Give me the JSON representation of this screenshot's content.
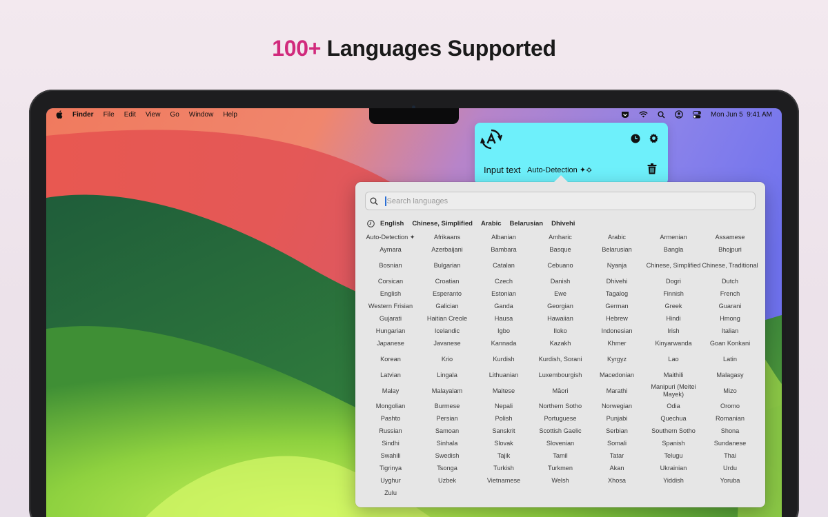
{
  "headline": {
    "accent": "100+",
    "rest": " Languages Supported"
  },
  "menubar": {
    "items": [
      "Finder",
      "File",
      "Edit",
      "View",
      "Go",
      "Window",
      "Help"
    ],
    "datetime": "Mon Jun 5  9:41 AM"
  },
  "popup": {
    "input_label": "Input text",
    "source_language": "Auto-Detection ✦≎"
  },
  "panel": {
    "search_placeholder": "Search languages",
    "recent": [
      "English",
      "Chinese, Simplified",
      "Arabic",
      "Belarusian",
      "Dhivehi"
    ],
    "languages": [
      [
        "Auto-Detection ✦",
        "Afrikaans",
        "Albanian",
        "Amharic",
        "Arabic",
        "Armenian",
        "Assamese"
      ],
      [
        "Aymara",
        "Azerbaijani",
        "Bambara",
        "Basque",
        "Belarusian",
        "Bangla",
        "Bhojpuri"
      ],
      [
        "Bosnian",
        "Bulgarian",
        "Catalan",
        "Cebuano",
        "Nyanja",
        "Chinese, Simplified",
        "Chinese, Traditional"
      ],
      [
        "Corsican",
        "Croatian",
        "Czech",
        "Danish",
        "Dhivehi",
        "Dogri",
        "Dutch"
      ],
      [
        "English",
        "Esperanto",
        "Estonian",
        "Ewe",
        "Tagalog",
        "Finnish",
        "French"
      ],
      [
        "Western Frisian",
        "Galician",
        "Ganda",
        "Georgian",
        "German",
        "Greek",
        "Guarani"
      ],
      [
        "Gujarati",
        "Haitian Creole",
        "Hausa",
        "Hawaiian",
        "Hebrew",
        "Hindi",
        "Hmong"
      ],
      [
        "Hungarian",
        "Icelandic",
        "Igbo",
        "Iloko",
        "Indonesian",
        "Irish",
        "Italian"
      ],
      [
        "Japanese",
        "Javanese",
        "Kannada",
        "Kazakh",
        "Khmer",
        "Kinyarwanda",
        "Goan Konkani"
      ],
      [
        "Korean",
        "Krio",
        "Kurdish",
        "Kurdish, Sorani",
        "Kyrgyz",
        "Lao",
        "Latin"
      ],
      [
        "Latvian",
        "Lingala",
        "Lithuanian",
        "Luxembourgish",
        "Macedonian",
        "Maithili",
        "Malagasy"
      ],
      [
        "Malay",
        "Malayalam",
        "Maltese",
        "Māori",
        "Marathi",
        "Manipuri (Meitei Mayek)",
        "Mizo"
      ],
      [
        "Mongolian",
        "Burmese",
        "Nepali",
        "Northern Sotho",
        "Norwegian",
        "Odia",
        "Oromo"
      ],
      [
        "Pashto",
        "Persian",
        "Polish",
        "Portuguese",
        "Punjabi",
        "Quechua",
        "Romanian"
      ],
      [
        "Russian",
        "Samoan",
        "Sanskrit",
        "Scottish Gaelic",
        "Serbian",
        "Southern Sotho",
        "Shona"
      ],
      [
        "Sindhi",
        "Sinhala",
        "Slovak",
        "Slovenian",
        "Somali",
        "Spanish",
        "Sundanese"
      ],
      [
        "Swahili",
        "Swedish",
        "Tajik",
        "Tamil",
        "Tatar",
        "Telugu",
        "Thai"
      ],
      [
        "Tigrinya",
        "Tsonga",
        "Turkish",
        "Turkmen",
        "Akan",
        "Ukrainian",
        "Urdu"
      ],
      [
        "Uyghur",
        "Uzbek",
        "Vietnamese",
        "Welsh",
        "Xhosa",
        "Yiddish",
        "Yoruba"
      ],
      [
        "Zulu"
      ]
    ]
  },
  "colors": {
    "accent": "#d12a7c",
    "popup_bg": "#6ef0fb",
    "panel_bg": "#e6e6e6"
  }
}
